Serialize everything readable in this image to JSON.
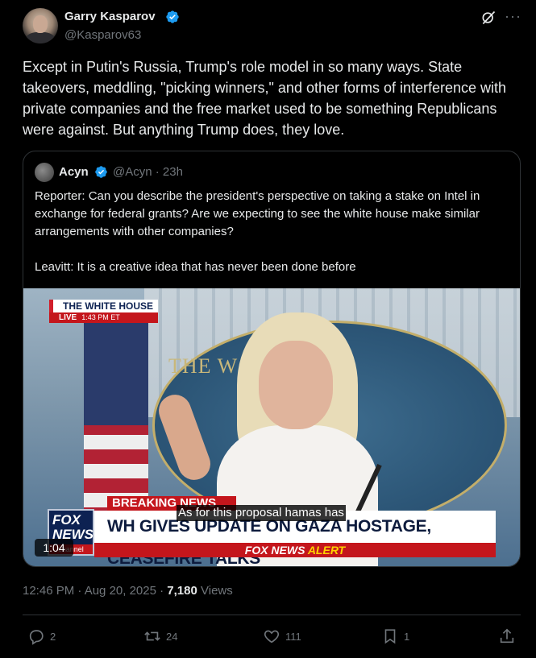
{
  "author": {
    "name": "Garry Kasparov",
    "handle": "@Kasparov63",
    "verified": true
  },
  "tweet_text": "Except in Putin's Russia, Trump's role model in so many ways. State takeovers, meddling, \"picking winners,\" and other forms of interference with private companies and the free market used to be something Republicans were against. But anything Trump does, they love.",
  "quoted": {
    "name": "Acyn",
    "handle": "@Acyn · 23h",
    "verified": true,
    "text": "Reporter: Can you describe the president's perspective on taking a stake on Intel in exchange for federal grants? Are we expecting to see the white house make similar arrangements with other companies?\n\nLeavitt: It is a creative idea that has never been done before",
    "video": {
      "wh_title": "THE WHITE HOUSE",
      "live_label": "LIVE",
      "live_time": "1:43 PM ET",
      "seal_text": "THE W      HOUSE",
      "breaking_label": "BREAKING NEWS",
      "headline": "WH GIVES UPDATE ON GAZA HOSTAGE, CEASEFIRE TALKS",
      "alert_brand": "FOX NEWS",
      "alert_word": "ALERT",
      "fox_logo_line1": "FOX",
      "fox_logo_line2": "NEWS",
      "fox_logo_line3": "channel",
      "caption": "As for this proposal hamas has",
      "duration": "1:04"
    }
  },
  "meta": {
    "time_date": "12:46 PM · Aug 20, 2025 · ",
    "views_count": "7,180",
    "views_label": " Views"
  },
  "actions": {
    "replies": "2",
    "reposts": "24",
    "likes": "111",
    "bookmarks": "1"
  },
  "icons": {
    "verified": "verified-badge-icon",
    "grok": "grok-icon",
    "more": "more-icon",
    "reply": "reply-icon",
    "repost": "repost-icon",
    "like": "like-icon",
    "bookmark": "bookmark-icon",
    "share": "share-icon"
  },
  "colors": {
    "background": "#000000",
    "text": "#e7e9ea",
    "muted": "#71767b",
    "border": "#2f3336",
    "verified": "#1d9bf0"
  }
}
